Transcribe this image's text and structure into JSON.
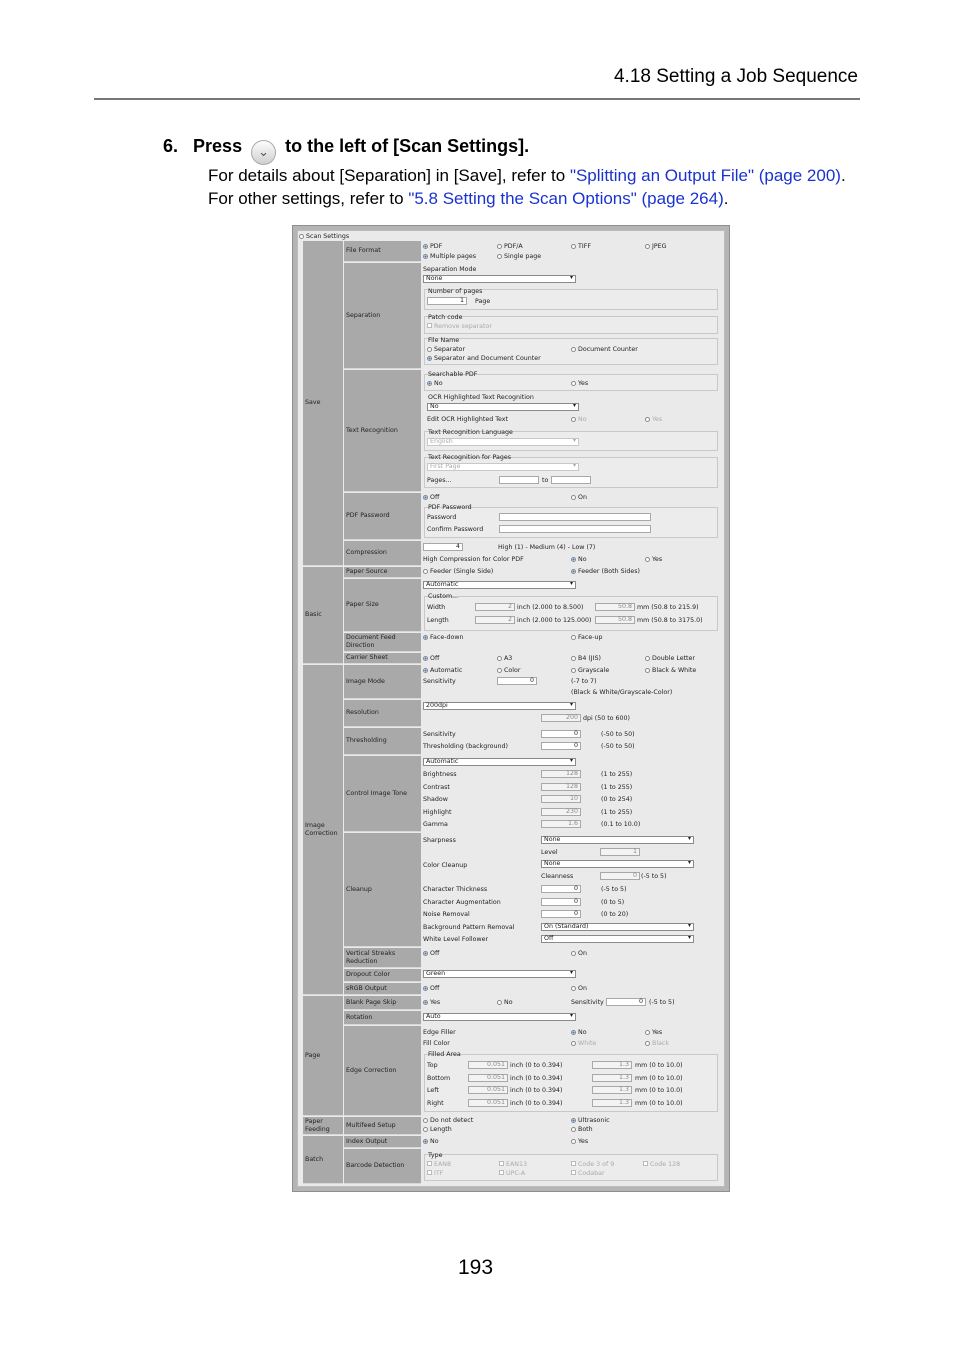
{
  "header": {
    "section": "4.18 Setting a Job Sequence"
  },
  "step": {
    "number": "6.",
    "before": "Press",
    "after": "to the left of [Scan Settings].",
    "icon": "chevron-down-icon"
  },
  "para": {
    "t1": "For details about [Separation] in [Save], refer to ",
    "link1": "\"Splitting an Output File\" (page 200)",
    "t2": ". For other settings, refer to ",
    "link2": "\"5.8 Setting the Scan Options\" (page 264)",
    "t3": ".",
    "link_color": "#1a33d0"
  },
  "page_number": "193",
  "ui": {
    "title": "Scan Settings",
    "groups": [
      "Save",
      "Basic",
      "Image Correction",
      "Page",
      "Paper Feeding",
      "Batch"
    ],
    "labels": [
      "File Format",
      "Separation",
      "Text Recognition",
      "PDF Password",
      "Compression",
      "Paper Source",
      "Paper Size",
      "Document Feed Direction",
      "Carrier Sheet",
      "Image Mode",
      "Resolution",
      "Thresholding",
      "Control Image Tone",
      "Cleanup",
      "Vertical Streaks Reduction",
      "Dropout Color",
      "sRGB Output",
      "Blank Page Skip",
      "Rotation",
      "Edge Correction",
      "Multifeed Setup",
      "Index Output",
      "Barcode Detection"
    ],
    "file_format": {
      "options": [
        "PDF",
        "PDF/A",
        "TIFF",
        "JPEG"
      ],
      "pages": [
        "Multiple pages",
        "Single page"
      ]
    },
    "separation": {
      "mode_label": "Separation Mode",
      "mode": "None",
      "num_pages_label": "Number of pages",
      "num_pages": "1",
      "page_unit": "Page",
      "patch_label": "Patch code",
      "remove_sep": "Remove separator",
      "file_name_label": "File Name",
      "fn_opts": [
        "Separator",
        "Document Counter",
        "Separator and Document Counter"
      ]
    },
    "text_recog": {
      "searchable": "Searchable PDF",
      "no": "No",
      "yes": "Yes",
      "ocr_hl": "OCR Highlighted Text Recognition",
      "ocr_val": "No",
      "edit_ocr": "Edit OCR Highlighted Text",
      "lang_label": "Text Recognition Language",
      "lang": "English",
      "pages_label": "Text Recognition for Pages",
      "pages_val": "First Page",
      "pages_range": "Pages...",
      "to": "to"
    },
    "pdf_password": {
      "off": "Off",
      "on": "On",
      "group": "PDF Password",
      "password": "Password",
      "confirm": "Confirm Password"
    },
    "compression": {
      "value": "4",
      "range": "High (1) - Medium (4) - Low (7)",
      "hc": "High Compression for Color PDF",
      "no": "No",
      "yes": "Yes"
    },
    "paper_source": {
      "opt1": "Feeder (Single Side)",
      "opt2": "Feeder (Both Sides)"
    },
    "paper_size": {
      "value": "Automatic",
      "custom": "Custom...",
      "width": "Width",
      "length": "Length",
      "w_in": "2",
      "w_in_range": "inch (2.000 to 8.500)",
      "w_mm": "50.8",
      "w_mm_range": "mm (50.8 to 215.9)",
      "l_in": "2",
      "l_in_range": "inch (2.000 to 125.000)",
      "l_mm": "50.8",
      "l_mm_range": "mm (50.8 to 3175.0)"
    },
    "feed_dir": {
      "opt1": "Face-down",
      "opt2": "Face-up"
    },
    "carrier": {
      "opts": [
        "Off",
        "A3",
        "B4 (JIS)",
        "Double Letter"
      ]
    },
    "image_mode": {
      "opts": [
        "Automatic",
        "Color",
        "Grayscale",
        "Black & White"
      ],
      "sens": "Sensitivity",
      "sens_val": "0",
      "sens_range": "(-7 to 7)",
      "note": "(Black & White/Grayscale-Color)"
    },
    "resolution": {
      "value": "200dpi",
      "dpi": "200",
      "dpi_range": "dpi (50 to 600)"
    },
    "thresholding": {
      "sens": "Sensitivity",
      "sens_val": "0",
      "sens_range": "(-50 to 50)",
      "bg": "Thresholding (background)",
      "bg_val": "0",
      "bg_range": "(-50 to 50)"
    },
    "tone": {
      "value": "Automatic",
      "rows": [
        {
          "k": "Brightness",
          "v": "128",
          "r": "(1 to 255)"
        },
        {
          "k": "Contrast",
          "v": "128",
          "r": "(1 to 255)"
        },
        {
          "k": "Shadow",
          "v": "10",
          "r": "(0 to 254)"
        },
        {
          "k": "Highlight",
          "v": "230",
          "r": "(1 to 255)"
        },
        {
          "k": "Gamma",
          "v": "1.6",
          "r": "(0.1 to 10.0)"
        }
      ]
    },
    "cleanup": {
      "sharp": "Sharpness",
      "sharp_val": "None",
      "level": "Level",
      "level_val": "1",
      "cc": "Color Cleanup",
      "cc_val": "None",
      "clean": "Cleanness",
      "clean_val": "0",
      "clean_range": "(-5 to 5)",
      "ct": "Character Thickness",
      "ct_val": "0",
      "ct_range": "(-5 to 5)",
      "ca": "Character Augmentation",
      "ca_val": "0",
      "ca_range": "(0 to 5)",
      "nr": "Noise Removal",
      "nr_val": "0",
      "nr_range": "(0 to 20)",
      "bpr": "Background Pattern Removal",
      "bpr_val": "On (Standard)",
      "wlf": "White Level Follower",
      "wlf_val": "Off"
    },
    "vsr": {
      "off": "Off",
      "on": "On"
    },
    "dropout": {
      "value": "Green"
    },
    "srgb": {
      "off": "Off",
      "on": "On"
    },
    "blank": {
      "yes": "Yes",
      "no": "No",
      "sens": "Sensitivity",
      "sens_val": "0",
      "sens_range": "(-5 to 5)"
    },
    "rotation": {
      "value": "Auto"
    },
    "edge": {
      "filler": "Edge Filler",
      "no": "No",
      "yes": "Yes",
      "fill": "Fill Color",
      "white": "White",
      "black": "Black",
      "area": "Filled Area",
      "rows": [
        {
          "k": "Top",
          "in": "0.051",
          "ir": "inch (0 to 0.394)",
          "mm": "1.3",
          "mr": "mm (0 to 10.0)"
        },
        {
          "k": "Bottom",
          "in": "0.051",
          "ir": "inch (0 to 0.394)",
          "mm": "1.3",
          "mr": "mm (0 to 10.0)"
        },
        {
          "k": "Left",
          "in": "0.051",
          "ir": "inch (0 to 0.394)",
          "mm": "1.3",
          "mr": "mm (0 to 10.0)"
        },
        {
          "k": "Right",
          "in": "0.051",
          "ir": "inch (0 to 0.394)",
          "mm": "1.3",
          "mr": "mm (0 to 10.0)"
        }
      ]
    },
    "multifeed": {
      "o1": "Do not detect",
      "o2": "Ultrasonic",
      "o3": "Length",
      "o4": "Both"
    },
    "index": {
      "no": "No",
      "yes": "Yes"
    },
    "barcode": {
      "type": "Type",
      "codes": [
        "EAN8",
        "EAN13",
        "Code 3 of 9",
        "Code 128",
        "ITF",
        "UPC-A",
        "Codabar"
      ]
    }
  }
}
